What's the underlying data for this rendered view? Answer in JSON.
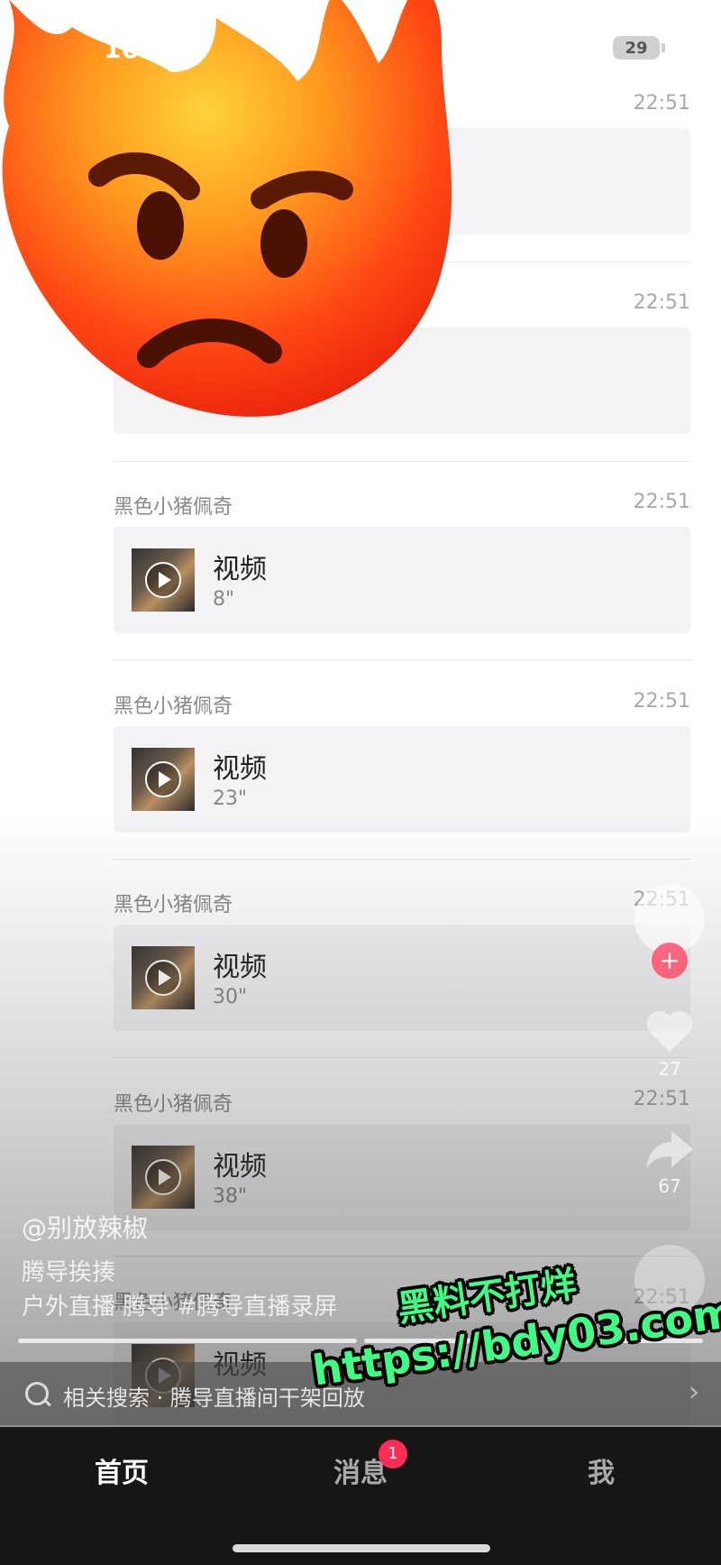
{
  "status_bar": {
    "time": "16:51",
    "battery": "29"
  },
  "messages": [
    {
      "sender": "",
      "time": "22:51",
      "title": "",
      "duration": ""
    },
    {
      "sender": "",
      "time": "22:51",
      "title": "",
      "duration": ""
    },
    {
      "sender": "黑色小猪佩奇",
      "time": "22:51",
      "title": "视频",
      "duration": "8\""
    },
    {
      "sender": "黑色小猪佩奇",
      "time": "22:51",
      "title": "视频",
      "duration": "23\""
    },
    {
      "sender": "黑色小猪佩奇",
      "time": "22:51",
      "title": "视频",
      "duration": "30\""
    },
    {
      "sender": "黑色小猪佩奇",
      "time": "22:51",
      "title": "视频",
      "duration": "38\""
    },
    {
      "sender": "黑色小猪佩奇",
      "time": "22:51",
      "title": "视频",
      "duration": ""
    }
  ],
  "video_overlay": {
    "author": "@别放辣椒",
    "title": "腾导挨揍",
    "description": "户外直播 腾导 #腾导直播录屏",
    "like_count": "27",
    "share_count": "67"
  },
  "search_bar": {
    "text": "相关搜索 · 腾导直播间干架回放"
  },
  "tab_bar": {
    "home": "首页",
    "messages": "消息",
    "messages_badge": "1",
    "me": "我"
  },
  "watermark": {
    "line1": "黑料不打烊",
    "line2": "https://bdy03.com"
  },
  "colors": {
    "tab_bg": "#161616",
    "badge": "#ff2d55",
    "watermark": "#3eff84"
  }
}
